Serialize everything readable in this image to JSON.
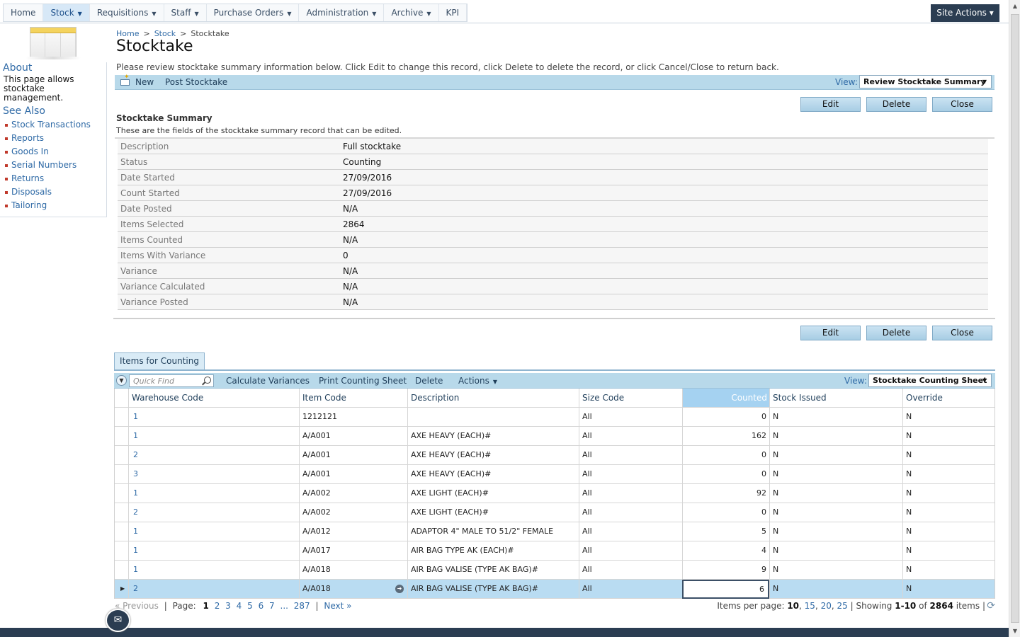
{
  "nav": {
    "items": [
      {
        "label": "Home",
        "has_menu": false
      },
      {
        "label": "Stock",
        "has_menu": true
      },
      {
        "label": "Requisitions",
        "has_menu": true
      },
      {
        "label": "Staff",
        "has_menu": true
      },
      {
        "label": "Purchase Orders",
        "has_menu": true
      },
      {
        "label": "Administration",
        "has_menu": true
      },
      {
        "label": "Archive",
        "has_menu": true
      },
      {
        "label": "KPI",
        "has_menu": false
      }
    ],
    "site_actions": "Site Actions ▾"
  },
  "left": {
    "about_title": "About",
    "about_text": "This page allows stocktake management.",
    "see_also_title": "See Also",
    "links": [
      "Stock Transactions",
      "Reports",
      "Goods In",
      "Serial Numbers",
      "Returns",
      "Disposals",
      "Tailoring"
    ]
  },
  "breadcrumb": {
    "home": "Home",
    "sep1": ">",
    "stock": "Stock",
    "sep2": ">",
    "current": "Stocktake"
  },
  "page_title": "Stocktake",
  "instruction": "Please review stocktake summary information below. Click Edit to change this record, click Delete to delete the record, or click Cancel/Close to return back.",
  "toolbar": {
    "new_label": "New",
    "post_label": "Post Stocktake",
    "view_label": "View:",
    "view_value": "Review Stocktake Summary"
  },
  "buttons": {
    "edit": "Edit",
    "delete": "Delete",
    "close": "Close"
  },
  "summary": {
    "title": "Stocktake Summary",
    "subtitle": "These are the fields of the stocktake summary record that can be edited.",
    "rows": [
      {
        "label": "Description",
        "value": "Full stocktake"
      },
      {
        "label": "Status",
        "value": "Counting"
      },
      {
        "label": "Date Started",
        "value": "27/09/2016"
      },
      {
        "label": "Count Started",
        "value": "27/09/2016"
      },
      {
        "label": "Date Posted",
        "value": "N/A"
      },
      {
        "label": "Items Selected",
        "value": "2864"
      },
      {
        "label": "Items Counted",
        "value": "N/A"
      },
      {
        "label": "Items With Variance",
        "value": "0"
      },
      {
        "label": "Variance",
        "value": "N/A"
      },
      {
        "label": "Variance Calculated",
        "value": "N/A"
      },
      {
        "label": "Variance Posted",
        "value": "N/A"
      }
    ]
  },
  "items_tab": "Items for Counting",
  "grid_toolbar": {
    "quick_find_placeholder": "Quick Find",
    "calculate": "Calculate Variances",
    "print": "Print Counting Sheet",
    "delete": "Delete",
    "actions": "Actions",
    "view_label": "View:",
    "view_value": "Stocktake Counting Sheet"
  },
  "grid": {
    "columns": [
      "Warehouse Code",
      "Item Code",
      "Description",
      "Size Code",
      "Counted",
      "Stock Issued",
      "Override"
    ],
    "rows": [
      {
        "warehouse": "1",
        "item": "1212121",
        "description": "",
        "size": "All",
        "counted": "0",
        "issued": "N",
        "override": "N"
      },
      {
        "warehouse": "1",
        "item": "A/A001",
        "description": "AXE HEAVY (EACH)#",
        "size": "All",
        "counted": "162",
        "issued": "N",
        "override": "N"
      },
      {
        "warehouse": "2",
        "item": "A/A001",
        "description": "AXE HEAVY (EACH)#",
        "size": "All",
        "counted": "0",
        "issued": "N",
        "override": "N"
      },
      {
        "warehouse": "3",
        "item": "A/A001",
        "description": "AXE HEAVY (EACH)#",
        "size": "All",
        "counted": "0",
        "issued": "N",
        "override": "N"
      },
      {
        "warehouse": "1",
        "item": "A/A002",
        "description": "AXE LIGHT (EACH)#",
        "size": "All",
        "counted": "92",
        "issued": "N",
        "override": "N"
      },
      {
        "warehouse": "2",
        "item": "A/A002",
        "description": "AXE LIGHT (EACH)#",
        "size": "All",
        "counted": "0",
        "issued": "N",
        "override": "N"
      },
      {
        "warehouse": "1",
        "item": "A/A012",
        "description": "ADAPTOR 4\" MALE TO 51/2\" FEMALE",
        "size": "All",
        "counted": "5",
        "issued": "N",
        "override": "N"
      },
      {
        "warehouse": "1",
        "item": "A/A017",
        "description": "AIR BAG TYPE AK (EACH)#",
        "size": "All",
        "counted": "4",
        "issued": "N",
        "override": "N"
      },
      {
        "warehouse": "1",
        "item": "A/A018",
        "description": "AIR BAG VALISE (TYPE AK BAG)#",
        "size": "All",
        "counted": "9",
        "issued": "N",
        "override": "N"
      },
      {
        "warehouse": "2",
        "item": "A/A018",
        "description": "AIR BAG VALISE (TYPE AK BAG)#",
        "size": "All",
        "counted": "6",
        "issued": "N",
        "override": "N",
        "selected": true
      }
    ]
  },
  "pager": {
    "previous": "« Previous",
    "page_label": "Page:",
    "pages": [
      "1",
      "2",
      "3",
      "4",
      "5",
      "6",
      "7"
    ],
    "ellipsis": "...",
    "last": "287",
    "next": "Next »",
    "items_per_page_label": "Items per page:",
    "sizes": [
      "10",
      "15",
      "20",
      "25"
    ],
    "showing_label": "Showing",
    "showing_range": "1-10",
    "of_label": "of",
    "total": "2864",
    "items_label": "items"
  },
  "colors": {
    "accent": "#b8d9ea",
    "header_dark": "#2b3d52",
    "link": "#2f6aa6",
    "selected_row": "#b9dcf2"
  },
  "icons": {
    "new": "new-item-icon",
    "search": "search-icon",
    "refresh": "refresh-icon",
    "mail": "mail-icon",
    "collapse": "collapse-icon"
  }
}
